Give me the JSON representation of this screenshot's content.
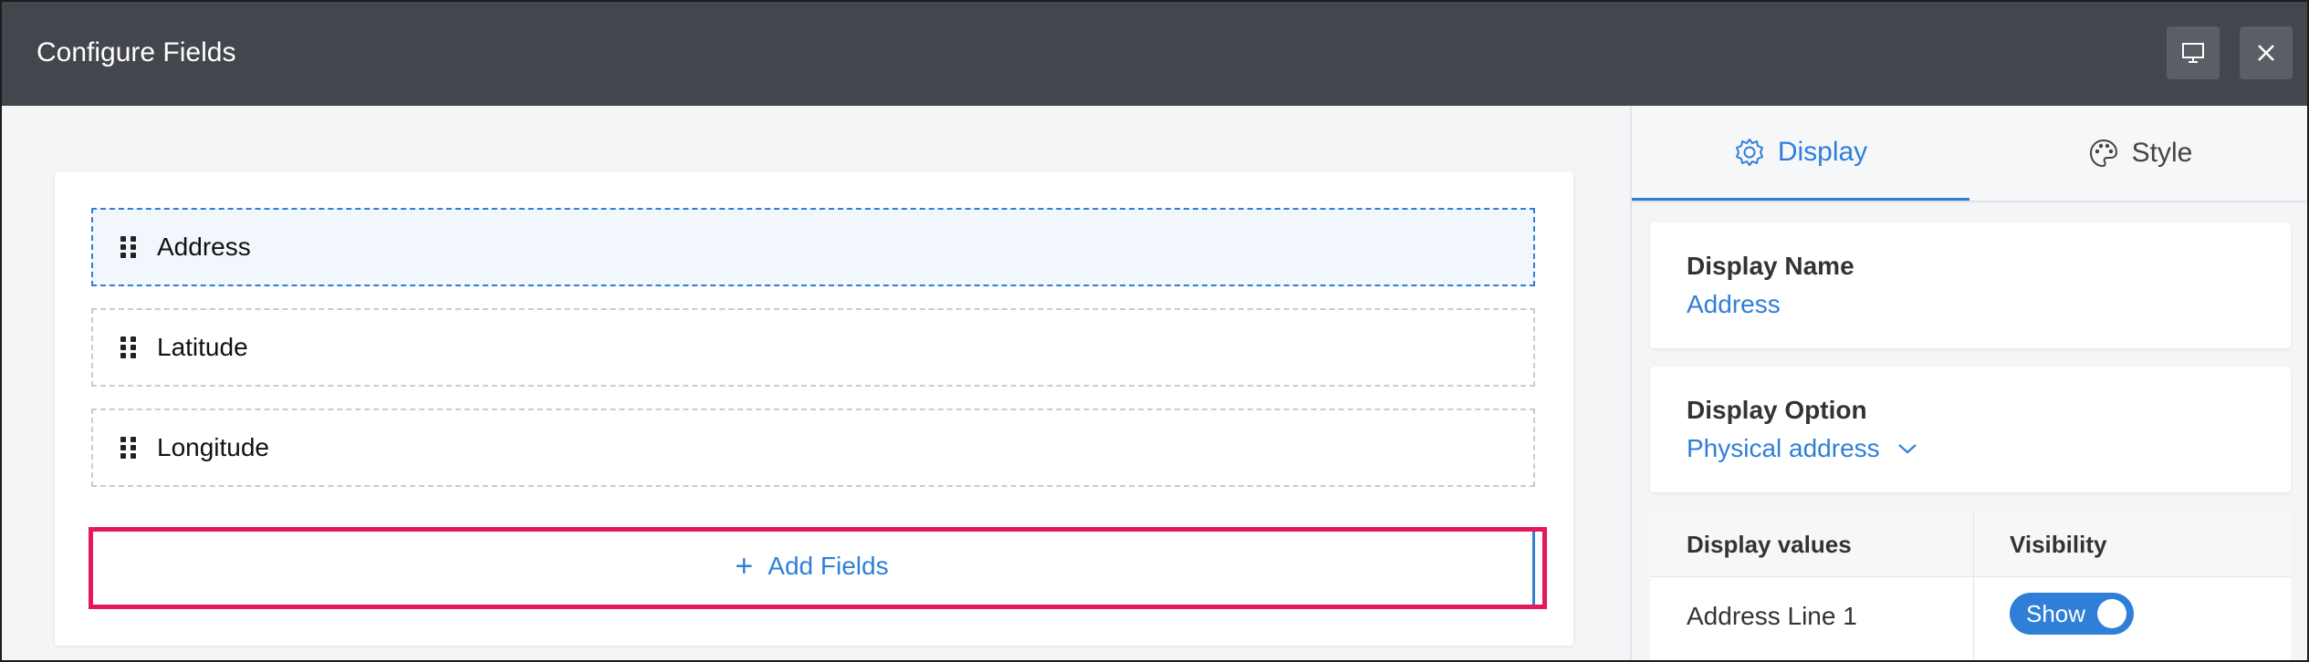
{
  "header": {
    "title": "Configure Fields",
    "monitor_icon": "monitor-icon",
    "close_icon": "close-icon"
  },
  "fields": [
    {
      "label": "Address",
      "selected": true
    },
    {
      "label": "Latitude",
      "selected": false
    },
    {
      "label": "Longitude",
      "selected": false
    }
  ],
  "add_fields": {
    "label": "Add Fields",
    "icon": "plus-icon"
  },
  "tabs": [
    {
      "label": "Display",
      "icon": "gear-icon",
      "active": true
    },
    {
      "label": "Style",
      "icon": "palette-icon",
      "active": false
    }
  ],
  "display_name": {
    "title": "Display Name",
    "value": "Address"
  },
  "display_option": {
    "title": "Display Option",
    "value": "Physical address"
  },
  "visibility_table": {
    "headers": [
      "Display values",
      "Visibility"
    ],
    "rows": [
      {
        "label": "Address Line 1",
        "toggle": "Show"
      }
    ]
  },
  "colors": {
    "accent": "#2f7fd8",
    "header_bg": "#44464d",
    "highlight": "#e4185a"
  }
}
